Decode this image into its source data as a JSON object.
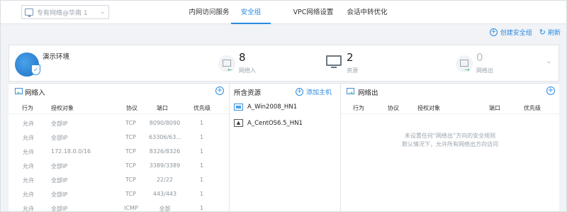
{
  "region": {
    "label": "专有网络@华南 1"
  },
  "tabs": [
    {
      "label": "内网访问服务"
    },
    {
      "label": "安全组"
    },
    {
      "label": "VPC网络设置"
    },
    {
      "label": "会话中转优化"
    }
  ],
  "actions": {
    "create": "创建安全组",
    "refresh": "刷新"
  },
  "summary": {
    "env_name": "演示环境",
    "inbound": {
      "count": "8",
      "label": "网络入"
    },
    "resources": {
      "count": "2",
      "label": "资源"
    },
    "outbound": {
      "count": "0",
      "label": "网络出"
    }
  },
  "inbound_panel": {
    "title": "网络入",
    "columns": [
      "行为",
      "授权对象",
      "协议",
      "端口",
      "优先级"
    ],
    "rows": [
      [
        "允许",
        "全部IP",
        "TCP",
        "8090/8090",
        "1"
      ],
      [
        "允许",
        "全部IP",
        "TCP",
        "63306/63...",
        "1"
      ],
      [
        "允许",
        "172.18.0.0/16",
        "TCP",
        "8326/8326",
        "1"
      ],
      [
        "允许",
        "全部IP",
        "TCP",
        "3389/3389",
        "1"
      ],
      [
        "允许",
        "全部IP",
        "TCP",
        "22/22",
        "1"
      ],
      [
        "允许",
        "全部IP",
        "TCP",
        "443/443",
        "1"
      ],
      [
        "允许",
        "全部IP",
        "ICMP",
        "全部",
        "1"
      ]
    ]
  },
  "resources_panel": {
    "title": "所含资源",
    "add_label": "添加主机",
    "items": [
      {
        "name": "A_Win2008_HN1",
        "icon": "windows-icon"
      },
      {
        "name": "A_CentOS6.5_HN1",
        "icon": "linux-icon"
      }
    ]
  },
  "outbound_panel": {
    "title": "网络出",
    "columns": [
      "行为",
      "协议",
      "授权对象",
      "端口",
      "优先级"
    ],
    "empty_line1": "未设置任何“网络出”方向的安全规则",
    "empty_line2": "默认情况下，允许所有网络出方向访问"
  },
  "colors": {
    "accent": "#2a8ae0",
    "success": "#3bb36b"
  }
}
